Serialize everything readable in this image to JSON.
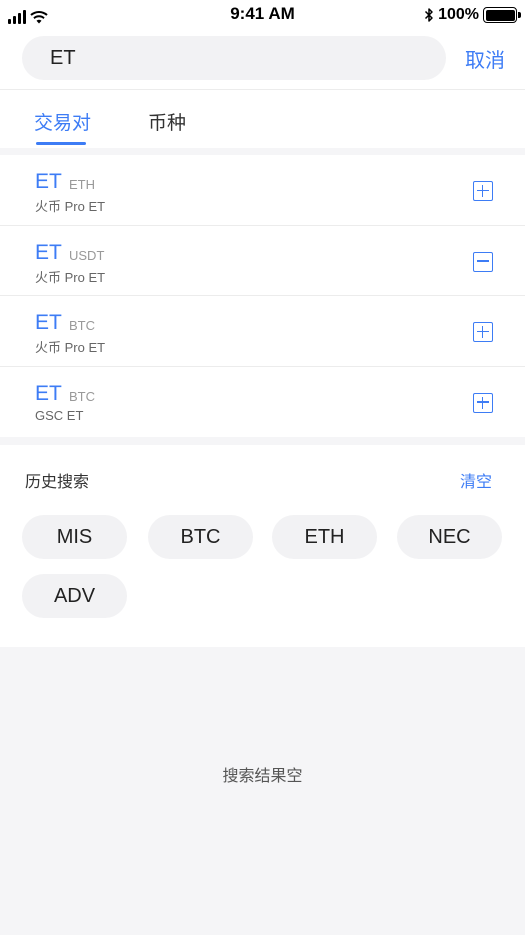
{
  "status_bar": {
    "time": "9:41 AM",
    "battery": "100%"
  },
  "search": {
    "value": "ET",
    "cancel_label": "取消"
  },
  "tabs": [
    {
      "label": "交易对",
      "active": true
    },
    {
      "label": "币种",
      "active": false
    }
  ],
  "results": [
    {
      "base": "ET",
      "quote": "ETH",
      "exchange": "火币 Pro ET",
      "action": "add"
    },
    {
      "base": "ET",
      "quote": "USDT",
      "exchange": "火币 Pro ET",
      "action": "remove"
    },
    {
      "base": "ET",
      "quote": "BTC",
      "exchange": "火币 Pro ET",
      "action": "add"
    },
    {
      "base": "ET",
      "quote": "BTC",
      "exchange": "GSC ET",
      "action": "add"
    }
  ],
  "history": {
    "title": "历史搜索",
    "clear_label": "清空",
    "items": [
      "MIS",
      "BTC",
      "ETH",
      "NEC",
      "ADV"
    ]
  },
  "empty_message": "搜索结果空",
  "colors": {
    "accent": "#3d7cf5",
    "background": "#f5f5f7",
    "chip": "#f2f2f4"
  }
}
